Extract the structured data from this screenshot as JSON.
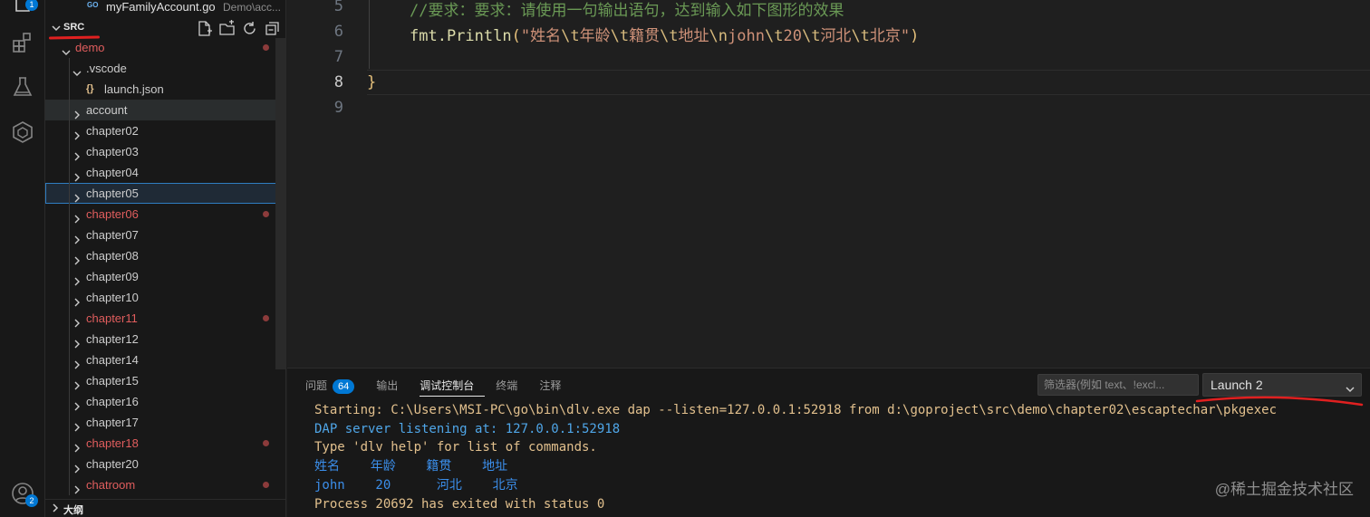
{
  "activity_bar": {
    "explorer_badge": "1",
    "accounts_badge": "2"
  },
  "open_editor": {
    "lang_badge": "GO",
    "file_name": "myFamilyAccount.go",
    "file_dir": "Demo\\acc..."
  },
  "explorer": {
    "root_label": "SRC",
    "outline_label": "大纲",
    "tree": [
      {
        "label": "demo",
        "modified": true
      },
      {
        "label": ".vscode",
        "modified": false
      },
      {
        "label": "launch.json",
        "modified": false,
        "icon": "{}"
      },
      {
        "label": "account",
        "modified": false
      },
      {
        "label": "chapter02",
        "modified": false
      },
      {
        "label": "chapter03",
        "modified": false
      },
      {
        "label": "chapter04",
        "modified": false
      },
      {
        "label": "chapter05",
        "modified": false
      },
      {
        "label": "chapter06",
        "modified": true
      },
      {
        "label": "chapter07",
        "modified": false
      },
      {
        "label": "chapter08",
        "modified": false
      },
      {
        "label": "chapter09",
        "modified": false
      },
      {
        "label": "chapter10",
        "modified": false
      },
      {
        "label": "chapter11",
        "modified": true
      },
      {
        "label": "chapter12",
        "modified": false
      },
      {
        "label": "chapter14",
        "modified": false
      },
      {
        "label": "chapter15",
        "modified": false
      },
      {
        "label": "chapter16",
        "modified": false
      },
      {
        "label": "chapter17",
        "modified": false
      },
      {
        "label": "chapter18",
        "modified": true
      },
      {
        "label": "chapter20",
        "modified": false
      },
      {
        "label": "chatroom",
        "modified": true
      }
    ]
  },
  "editor": {
    "line_numbers": [
      "5",
      "6",
      "7",
      "8",
      "9"
    ],
    "active_line": "8",
    "comment_line": "//要求：要求：请使用一句输出语句，达到输入如下图形的效果",
    "code_fn": "fmt.Println",
    "code_open": "(",
    "code_str_parts": [
      "\"姓名",
      "\\t",
      "年龄",
      "\\t",
      "籍贯",
      "\\t",
      "地址",
      "\\n",
      "john",
      "\\t",
      "20",
      "\\t",
      "河北",
      "\\t",
      "北京\""
    ],
    "code_close": ")",
    "closing_brace": "}"
  },
  "panel": {
    "tabs": [
      {
        "label": "问题",
        "count": "64",
        "active": false
      },
      {
        "label": "输出",
        "active": false
      },
      {
        "label": "调试控制台",
        "active": true
      },
      {
        "label": "终端",
        "active": false
      },
      {
        "label": "注释",
        "active": false
      }
    ],
    "filter_placeholder": "筛选器(例如 text、!excl...",
    "launch_select": "Launch 2",
    "console_lines": [
      {
        "text": "Starting: C:\\Users\\MSI-PC\\go\\bin\\dlv.exe dap --listen=127.0.0.1:52918 from d:\\goproject\\src\\demo\\chapter02\\escaptechar\\pkgexec",
        "style": "yellow"
      },
      {
        "text": "DAP server listening at: 127.0.0.1:52918",
        "style": "blue"
      },
      {
        "text": "Type 'dlv help' for list of commands.",
        "style": "yellow"
      },
      {
        "text": "姓名    年龄    籍贯    地址",
        "style": "out"
      },
      {
        "text": "john    20      河北    北京",
        "style": "out"
      },
      {
        "text": "Process 20692 has exited with status 0",
        "style": "yellow"
      }
    ]
  },
  "watermark": "@稀土掘金技术社区",
  "colors": {
    "accent": "#0078d4",
    "modified": "#e05d5d",
    "annotation_red": "#e02020"
  }
}
